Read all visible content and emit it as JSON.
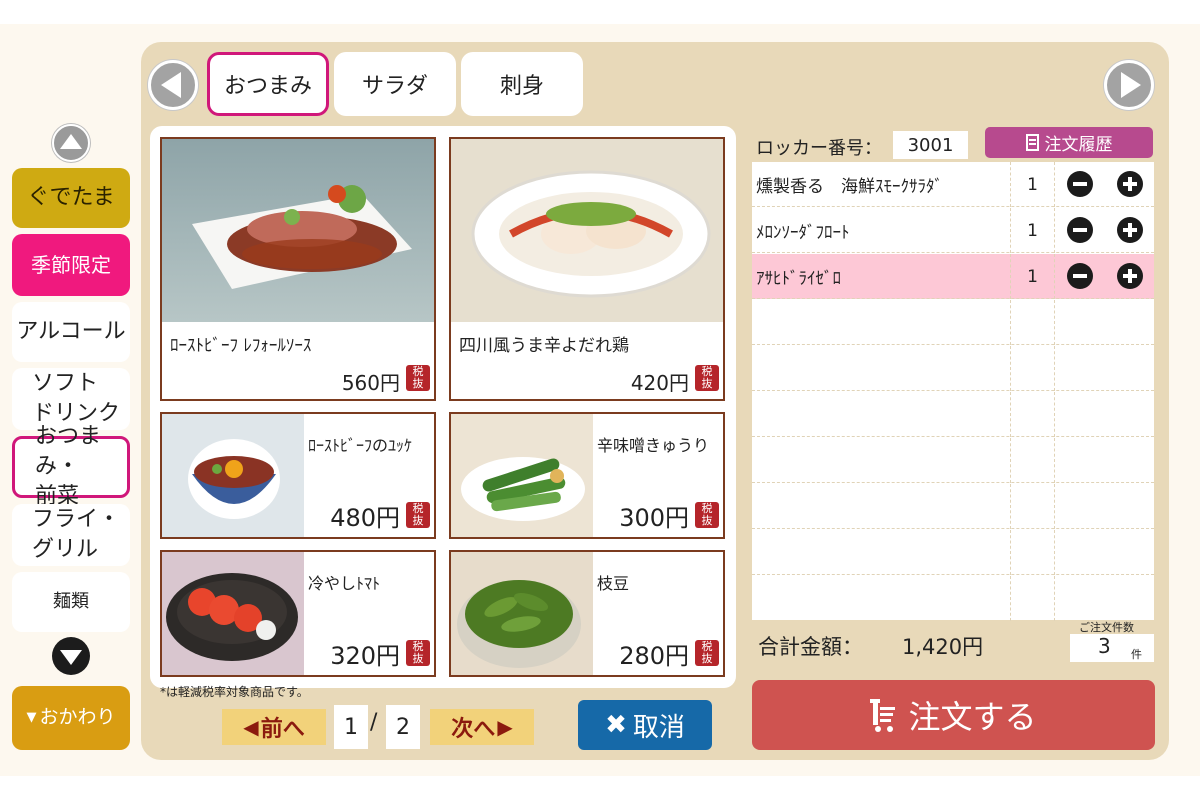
{
  "categories": {
    "items": [
      {
        "label": "ぐでたま"
      },
      {
        "label": "季節限定"
      },
      {
        "label": "アルコール"
      },
      {
        "label_line1": "ソフト",
        "label_line2": "ドリンク"
      },
      {
        "label_line1": "おつまみ・",
        "label_line2": "前菜"
      },
      {
        "label_line1": "フライ・",
        "label_line2": "グリル"
      },
      {
        "label": "麺類"
      }
    ],
    "refill": "おかわり",
    "selected": "おつまみ・前菜"
  },
  "tabs": [
    {
      "label": "おつまみ"
    },
    {
      "label": "サラダ"
    },
    {
      "label": "刺身"
    }
  ],
  "menu": {
    "items": [
      {
        "name": "ﾛｰｽﾄﾋﾞｰﾌ ﾚﾌｫｰﾙｿｰｽ",
        "price": "560円",
        "tax": "税抜"
      },
      {
        "name": "四川風うま辛よだれ鶏",
        "price": "420円",
        "tax": "税抜"
      },
      {
        "name": "ﾛｰｽﾄﾋﾞｰﾌのﾕｯｹ",
        "price": "480円",
        "tax": "税抜"
      },
      {
        "name": "辛味噌きゅうり",
        "price": "300円",
        "tax": "税抜"
      },
      {
        "name": "冷やしﾄﾏﾄ",
        "price": "320円",
        "tax": "税抜"
      },
      {
        "name": "枝豆",
        "price": "280円",
        "tax": "税抜"
      }
    ],
    "note": "*は軽減税率対象商品です。"
  },
  "pager": {
    "prev": "前へ",
    "next": "次へ",
    "current": "1",
    "separator": "/",
    "total": "2"
  },
  "cancel": {
    "label": "取消"
  },
  "order": {
    "locker_label": "ロッカー番号：",
    "locker_number": "3001",
    "history_label": "注文履歴",
    "rows": [
      {
        "name": "燻製香る　海鮮ｽﾓｰｸｻﾗﾀﾞ",
        "qty": "1"
      },
      {
        "name": "ﾒﾛﾝｿｰﾀﾞﾌﾛｰﾄ",
        "qty": "1"
      },
      {
        "name": "ｱｻﾋﾄﾞﾗｲｾﾞﾛ",
        "qty": "1"
      }
    ],
    "total_label": "合計金額：",
    "total_value": "1,420円",
    "count_label": "ご注文件数",
    "count_value": "3",
    "count_unit": "件",
    "submit_label": "注文する"
  },
  "colors": {
    "panel": "#e8d9b9",
    "selected_border": "#d0177a",
    "gudetama": "#cfaa12",
    "seasonal": "#f0197e",
    "refill": "#d99d12",
    "cancel": "#1669a8",
    "submit": "#cf5350",
    "history": "#b74a8e",
    "selected_row": "#fdc8d6",
    "tax_badge": "#b5252a"
  }
}
